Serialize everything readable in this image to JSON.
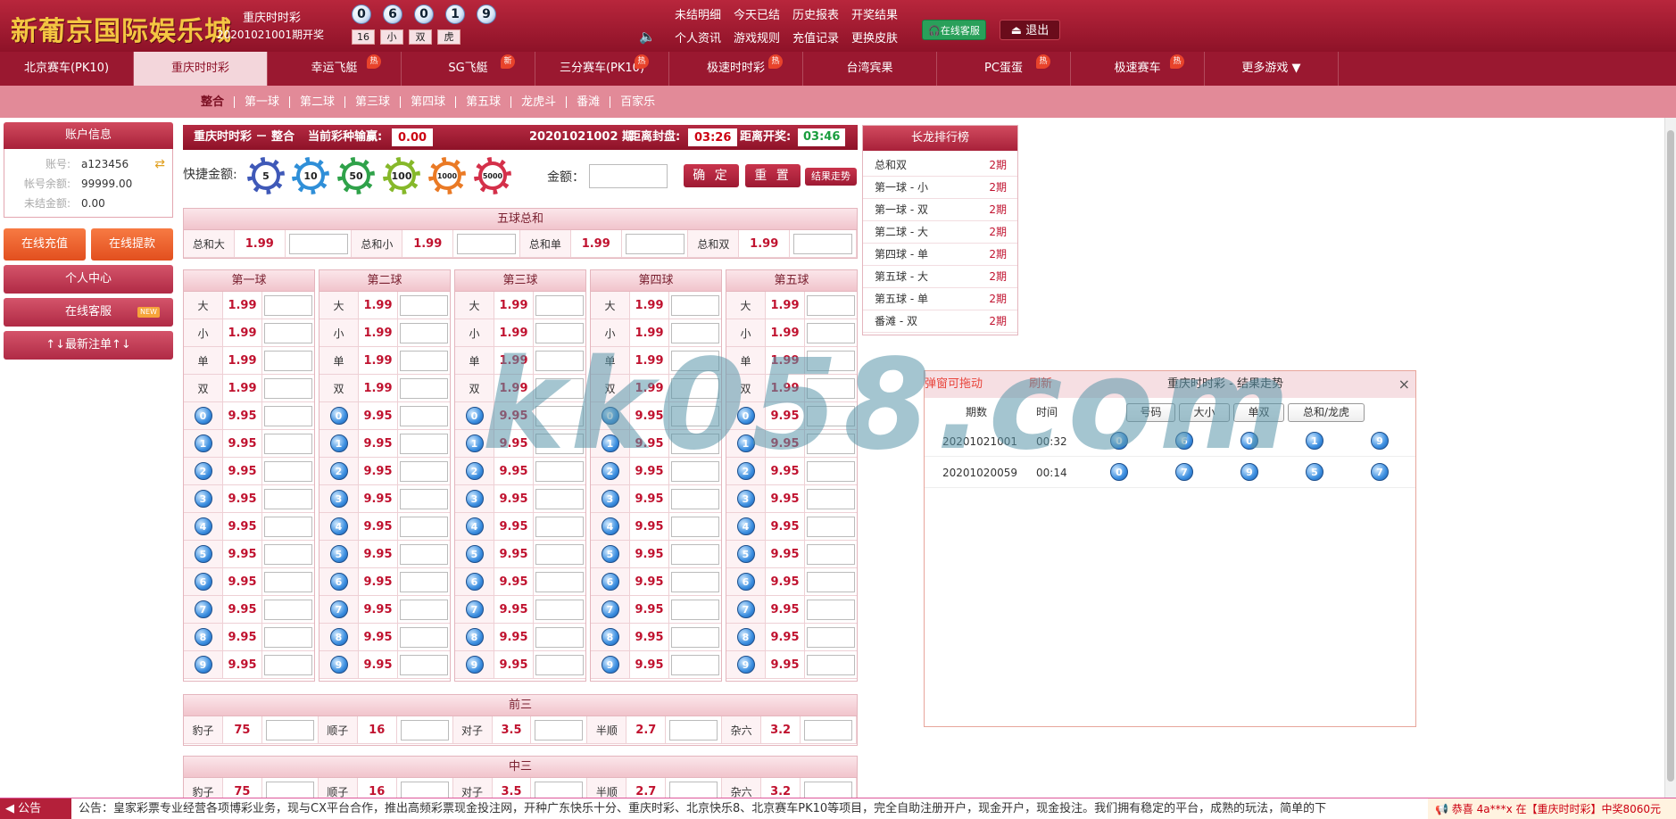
{
  "logo": "新葡京国际娱乐城",
  "header": {
    "lottery_name": "重庆时时彩",
    "issue_text": "20201021001期开奖",
    "balls": [
      "0",
      "6",
      "0",
      "1",
      "9"
    ],
    "tags": [
      "16",
      "小",
      "双",
      "虎"
    ],
    "links": [
      "未结明细",
      "今天已结",
      "历史报表",
      "开奖结果",
      "个人资讯",
      "游戏规则",
      "充值记录",
      "更换皮肤"
    ],
    "service_btn": "在线客服",
    "logout_btn": "退出"
  },
  "nav": {
    "items": [
      {
        "label": "北京赛车(PK10)",
        "badge": ""
      },
      {
        "label": "重庆时时彩",
        "badge": ""
      },
      {
        "label": "幸运飞艇",
        "badge": "热"
      },
      {
        "label": "SG飞艇",
        "badge": "新"
      },
      {
        "label": "三分赛车(PK10)",
        "badge": "热"
      },
      {
        "label": "极速时时彩",
        "badge": "热"
      },
      {
        "label": "台湾宾果",
        "badge": ""
      },
      {
        "label": "PC蛋蛋",
        "badge": "热"
      },
      {
        "label": "极速赛车",
        "badge": "热"
      },
      {
        "label": "更多游戏  ▼",
        "badge": ""
      }
    ],
    "active": 1
  },
  "subnav": [
    "整合",
    "第一球",
    "第二球",
    "第三球",
    "第四球",
    "第五球",
    "龙虎斗",
    "番滩",
    "百家乐"
  ],
  "account": {
    "title": "账户信息",
    "rows": [
      {
        "k": "账号:",
        "v": "a123456"
      },
      {
        "k": "帐号余额:",
        "v": "99999.00"
      },
      {
        "k": "未结金额:",
        "v": "0.00"
      }
    ],
    "recharge": "在线充值",
    "withdraw": "在线提款",
    "personal": "个人中心",
    "service": "在线客服",
    "service_badge": "NEW",
    "latest": "↑↓最新注单↑↓"
  },
  "bar": {
    "title": "重庆时时彩 － 整合",
    "win_label": "当前彩种输赢:",
    "win_value": "0.00",
    "issue": "20201021002 期",
    "close_label": "距离封盘:",
    "close_time": "03:26",
    "open_label": "距离开奖:",
    "open_time": "03:46"
  },
  "quick": {
    "label": "快捷金额:",
    "chips": [
      "5",
      "10",
      "50",
      "100",
      "1000",
      "5000"
    ],
    "amount_label": "金额：",
    "confirm": "确 定",
    "reset": "重 置",
    "trend": "结果走势"
  },
  "sum_table": {
    "title": "五球总和",
    "items": [
      {
        "k": "总和大",
        "v": "1.99"
      },
      {
        "k": "总和小",
        "v": "1.99"
      },
      {
        "k": "总和单",
        "v": "1.99"
      },
      {
        "k": "总和双",
        "v": "1.99"
      }
    ]
  },
  "balls_tables": {
    "titles": [
      "第一球",
      "第二球",
      "第三球",
      "第四球",
      "第五球"
    ],
    "labels": [
      "大",
      "小",
      "单",
      "双"
    ],
    "label_odds": "1.99",
    "numbers": [
      "0",
      "1",
      "2",
      "3",
      "4",
      "5",
      "6",
      "7",
      "8",
      "9"
    ],
    "number_odds": "9.95"
  },
  "front3": {
    "title": "前三",
    "items": [
      {
        "k": "豹子",
        "v": "75"
      },
      {
        "k": "顺子",
        "v": "16"
      },
      {
        "k": "对子",
        "v": "3.5"
      },
      {
        "k": "半顺",
        "v": "2.7"
      },
      {
        "k": "杂六",
        "v": "3.2"
      }
    ]
  },
  "mid3": {
    "title": "中三",
    "items": [
      {
        "k": "豹子",
        "v": "75"
      },
      {
        "k": "顺子",
        "v": "16"
      },
      {
        "k": "对子",
        "v": "3.5"
      },
      {
        "k": "半顺",
        "v": "2.7"
      },
      {
        "k": "杂六",
        "v": "3.2"
      }
    ]
  },
  "dragon": {
    "title": "长龙排行榜",
    "rows": [
      {
        "k": "总和双",
        "v": "2期"
      },
      {
        "k": "第一球 - 小",
        "v": "2期"
      },
      {
        "k": "第一球 - 双",
        "v": "2期"
      },
      {
        "k": "第二球 - 大",
        "v": "2期"
      },
      {
        "k": "第四球 - 单",
        "v": "2期"
      },
      {
        "k": "第五球 - 大",
        "v": "2期"
      },
      {
        "k": "第五球 - 单",
        "v": "2期"
      },
      {
        "k": "番滩 - 双",
        "v": "2期"
      }
    ]
  },
  "trend": {
    "drag": "弹窗可拖动",
    "refresh": "刷新",
    "title": "重庆时时彩 - 结果走势",
    "close": "×",
    "col_issue": "期数",
    "col_time": "时间",
    "tabs": [
      "号码",
      "大小",
      "单双",
      "总和/龙虎"
    ],
    "rows": [
      {
        "issue": "20201021001",
        "time": "00:32",
        "balls": [
          "0",
          "6",
          "0",
          "1",
          "9"
        ]
      },
      {
        "issue": "20201020059",
        "time": "00:14",
        "balls": [
          "0",
          "7",
          "9",
          "5",
          "7"
        ]
      }
    ]
  },
  "watermark": "kk058.com",
  "notice": {
    "label": "公告",
    "text": "公告：皇家彩票专业经营各项博彩业务，现与CX平台合作，推出高频彩票现金投注网，开种广东快乐十分、重庆时彩、北京快乐8、北京赛车PK10等项目，完全自助注册开户，现金开户，现金投注。我们拥有稳定的平台，成熟的玩法，简单的下",
    "winner": "恭喜 4a***x 在【重庆时时彩】中奖8060元"
  },
  "colors": {
    "primary": "#9a1830",
    "accent": "#c0122f",
    "subnav": "#e28a98"
  }
}
